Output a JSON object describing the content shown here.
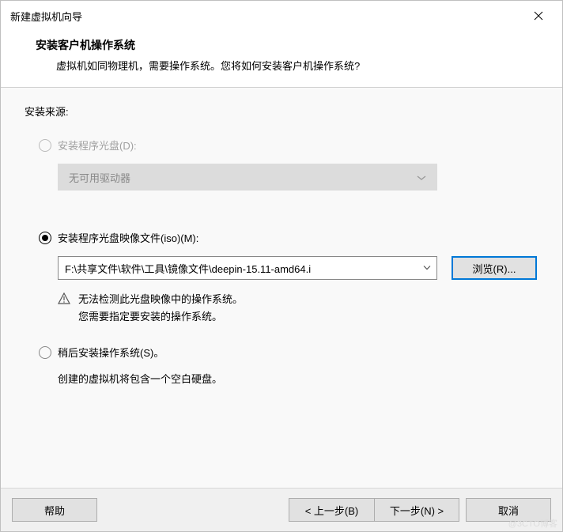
{
  "window": {
    "title": "新建虚拟机向导"
  },
  "header": {
    "title": "安装客户机操作系统",
    "description": "虚拟机如同物理机，需要操作系统。您将如何安装客户机操作系统?"
  },
  "source": {
    "label": "安装来源:",
    "optionDisc": {
      "label": "安装程序光盘(D):",
      "dropdownValue": "无可用驱动器"
    },
    "optionIso": {
      "label": "安装程序光盘映像文件(iso)(M):",
      "path": "F:\\共享文件\\软件\\工具\\镜像文件\\deepin-15.11-amd64.i",
      "browseLabel": "浏览(R)...",
      "warnLine1": "无法检测此光盘映像中的操作系统。",
      "warnLine2": "您需要指定要安装的操作系统。"
    },
    "optionLater": {
      "label": "稍后安装操作系统(S)。",
      "info": "创建的虚拟机将包含一个空白硬盘。"
    }
  },
  "buttons": {
    "help": "帮助",
    "back": "< 上一步(B)",
    "next": "下一步(N) >",
    "cancel": "取消"
  },
  "watermark": "@3CTO博客"
}
